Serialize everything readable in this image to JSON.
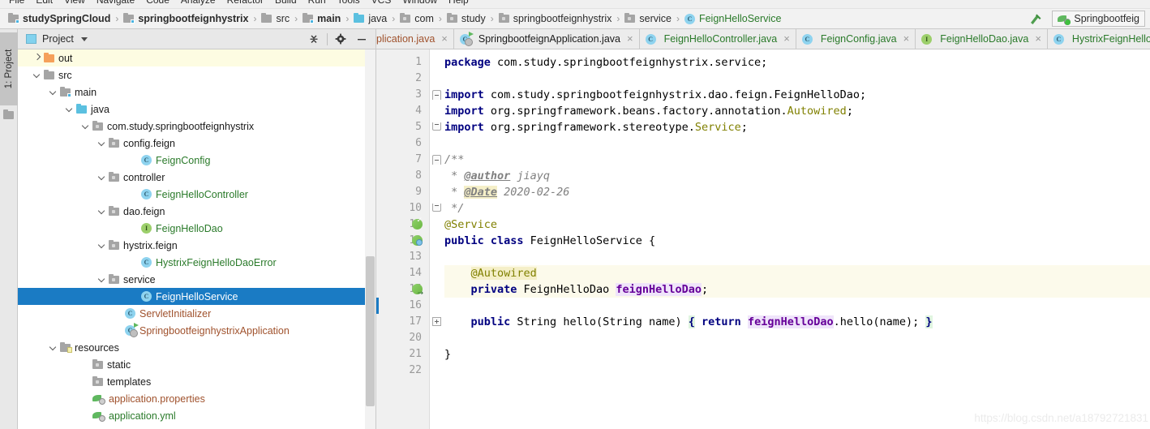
{
  "menubar": {
    "items": [
      "File",
      "Edit",
      "View",
      "Navigate",
      "Code",
      "Analyze",
      "Refactor",
      "Build",
      "Run",
      "Tools",
      "VCS",
      "Window",
      "Help"
    ]
  },
  "breadcrumb": {
    "items": [
      {
        "label": "studySpringCloud",
        "icon": "module-folder-icon",
        "bold": true
      },
      {
        "label": "springbootfeignhystrix",
        "icon": "module-folder-icon",
        "bold": true
      },
      {
        "label": "src",
        "icon": "folder-icon",
        "bold": false
      },
      {
        "label": "main",
        "icon": "source-folder-icon",
        "bold": true
      },
      {
        "label": "java",
        "icon": "java-folder-icon",
        "bold": false
      },
      {
        "label": "com",
        "icon": "package-icon",
        "bold": false
      },
      {
        "label": "study",
        "icon": "package-icon",
        "bold": false
      },
      {
        "label": "springbootfeignhystrix",
        "icon": "package-icon",
        "bold": false
      },
      {
        "label": "service",
        "icon": "package-icon",
        "bold": false
      },
      {
        "label": "FeignHelloService",
        "icon": "class-icon",
        "bold": false,
        "green": true
      }
    ]
  },
  "toolbar": {
    "build_icon": "hammer-icon",
    "run_configuration": "Springbootfeig"
  },
  "tool_window_tab": {
    "label": "1: Project",
    "icon": "project-icon"
  },
  "project_panel": {
    "title": "Project",
    "dropdown_icon": "chevron-down-icon",
    "collapse_all_icon": "collapse-all-icon",
    "settings_icon": "gear-icon",
    "hide_icon": "minimize-icon",
    "tree": [
      {
        "label": "out",
        "indent": 2,
        "arrow": "right",
        "icon": "folder-orange-icon",
        "color": "black",
        "highlight": true
      },
      {
        "label": "src",
        "indent": 2,
        "arrow": "down",
        "icon": "folder-icon",
        "color": "black"
      },
      {
        "label": "main",
        "indent": 3,
        "arrow": "down",
        "icon": "source-folder-icon",
        "color": "black"
      },
      {
        "label": "java",
        "indent": 4,
        "arrow": "down",
        "icon": "java-folder-icon",
        "color": "black"
      },
      {
        "label": "com.study.springbootfeignhystrix",
        "indent": 5,
        "arrow": "down",
        "icon": "package-icon",
        "color": "black"
      },
      {
        "label": "config.feign",
        "indent": 6,
        "arrow": "down",
        "icon": "package-icon",
        "color": "black"
      },
      {
        "label": "FeignConfig",
        "indent": 8,
        "arrow": "none",
        "icon": "class-icon",
        "color": "green"
      },
      {
        "label": "controller",
        "indent": 6,
        "arrow": "down",
        "icon": "package-icon",
        "color": "black"
      },
      {
        "label": "FeignHelloController",
        "indent": 8,
        "arrow": "none",
        "icon": "class-icon",
        "color": "green"
      },
      {
        "label": "dao.feign",
        "indent": 6,
        "arrow": "down",
        "icon": "package-icon",
        "color": "black"
      },
      {
        "label": "FeignHelloDao",
        "indent": 8,
        "arrow": "none",
        "icon": "interface-icon",
        "color": "green"
      },
      {
        "label": "hystrix.feign",
        "indent": 6,
        "arrow": "down",
        "icon": "package-icon",
        "color": "black"
      },
      {
        "label": "HystrixFeignHelloDaoError",
        "indent": 8,
        "arrow": "none",
        "icon": "class-icon",
        "color": "green"
      },
      {
        "label": "service",
        "indent": 6,
        "arrow": "down",
        "icon": "package-icon",
        "color": "black"
      },
      {
        "label": "FeignHelloService",
        "indent": 8,
        "arrow": "none",
        "icon": "class-icon",
        "color": "green",
        "selected": true
      },
      {
        "label": "ServletInitializer",
        "indent": 7,
        "arrow": "none",
        "icon": "class-icon",
        "color": "brown"
      },
      {
        "label": "SpringbootfeignhystrixApplication",
        "indent": 7,
        "arrow": "none",
        "icon": "spring-class-icon",
        "color": "brown"
      },
      {
        "label": "resources",
        "indent": 3,
        "arrow": "down",
        "icon": "resource-folder-icon",
        "color": "black"
      },
      {
        "label": "static",
        "indent": 5,
        "arrow": "none",
        "icon": "package-icon",
        "color": "black"
      },
      {
        "label": "templates",
        "indent": 5,
        "arrow": "none",
        "icon": "package-icon",
        "color": "black"
      },
      {
        "label": "application.properties",
        "indent": 5,
        "arrow": "none",
        "icon": "spring-file-icon",
        "color": "brown"
      },
      {
        "label": "application.yml",
        "indent": 5,
        "arrow": "none",
        "icon": "spring-file-icon",
        "color": "green"
      }
    ]
  },
  "editor_tabs": [
    {
      "label": "plication.java",
      "icon": "none",
      "color": "brown",
      "clipped": true,
      "close": "×"
    },
    {
      "label": "SpringbootfeignApplication.java",
      "icon": "spring-class-icon",
      "color": "black",
      "close": "×"
    },
    {
      "label": "FeignHelloController.java",
      "icon": "class-icon",
      "color": "green",
      "close": "×"
    },
    {
      "label": "FeignConfig.java",
      "icon": "class-icon",
      "color": "green",
      "close": "×"
    },
    {
      "label": "FeignHelloDao.java",
      "icon": "interface-icon",
      "color": "green",
      "close": "×"
    },
    {
      "label": "HystrixFeignHello",
      "icon": "class-icon",
      "color": "green",
      "clippedRight": true
    }
  ],
  "editor": {
    "line_numbers": [
      "1",
      "2",
      "3",
      "4",
      "5",
      "6",
      "7",
      "8",
      "9",
      "10",
      "11",
      "12",
      "13",
      "14",
      "15",
      "16",
      "17",
      "20",
      "21",
      "22"
    ],
    "current_line": "15",
    "code_lines": [
      {
        "n": "1",
        "tokens": [
          {
            "t": "package ",
            "c": "kw"
          },
          {
            "t": "com.study.springbootfeignhystrix.service;",
            "c": "txt"
          }
        ]
      },
      {
        "n": "2",
        "tokens": []
      },
      {
        "n": "3",
        "tokens": [
          {
            "t": "import ",
            "c": "kw"
          },
          {
            "t": "com.study.springbootfeignhystrix.dao.feign.FeignHelloDao;",
            "c": "txt"
          }
        ]
      },
      {
        "n": "4",
        "tokens": [
          {
            "t": "import ",
            "c": "kw"
          },
          {
            "t": "org.springframework.beans.factory.annotation.",
            "c": "txt"
          },
          {
            "t": "Autowired",
            "c": "ann"
          },
          {
            "t": ";",
            "c": "txt"
          }
        ]
      },
      {
        "n": "5",
        "tokens": [
          {
            "t": "import ",
            "c": "kw"
          },
          {
            "t": "org.springframework.stereotype.",
            "c": "txt"
          },
          {
            "t": "Service",
            "c": "ann"
          },
          {
            "t": ";",
            "c": "txt"
          }
        ]
      },
      {
        "n": "6",
        "tokens": []
      },
      {
        "n": "7",
        "tokens": [
          {
            "t": "/**",
            "c": "cmt"
          }
        ]
      },
      {
        "n": "8",
        "tokens": [
          {
            "t": " * ",
            "c": "cmt"
          },
          {
            "t": "@author",
            "c": "cmtTag"
          },
          {
            "t": " jiayq",
            "c": "cmt"
          }
        ]
      },
      {
        "n": "9",
        "tokens": [
          {
            "t": " * ",
            "c": "cmt"
          },
          {
            "t": "@Date",
            "c": "cmtTagHl"
          },
          {
            "t": " 2020-02-26",
            "c": "cmt"
          }
        ]
      },
      {
        "n": "10",
        "tokens": [
          {
            "t": " */",
            "c": "cmt"
          }
        ]
      },
      {
        "n": "11",
        "tokens": [
          {
            "t": "@Service",
            "c": "ann"
          }
        ]
      },
      {
        "n": "12",
        "tokens": [
          {
            "t": "public class ",
            "c": "kw"
          },
          {
            "t": "FeignHelloService {",
            "c": "txt"
          }
        ]
      },
      {
        "n": "13",
        "tokens": []
      },
      {
        "n": "14",
        "tokens": [
          {
            "t": "    ",
            "c": "txt"
          },
          {
            "t": "@Autowired",
            "c": "annb"
          }
        ]
      },
      {
        "n": "15",
        "tokens": [
          {
            "t": "    ",
            "c": "txt"
          },
          {
            "t": "private ",
            "c": "kw"
          },
          {
            "t": "FeignHelloDao ",
            "c": "txt"
          },
          {
            "t": "feignHelloDao",
            "c": "fld"
          },
          {
            "t": ";",
            "c": "txt"
          }
        ]
      },
      {
        "n": "16",
        "tokens": []
      },
      {
        "n": "17",
        "tokens": [
          {
            "t": "    ",
            "c": "txt"
          },
          {
            "t": "public ",
            "c": "kw"
          },
          {
            "t": "String hello(String name) ",
            "c": "txt"
          },
          {
            "t": "{",
            "c": "brace-hl"
          },
          {
            "t": " ",
            "c": "txt"
          },
          {
            "t": "return ",
            "c": "kw"
          },
          {
            "t": "feignHelloDao",
            "c": "fld"
          },
          {
            "t": ".hello(name); ",
            "c": "txt"
          },
          {
            "t": "}",
            "c": "brace-hl"
          }
        ]
      },
      {
        "n": "20",
        "tokens": []
      },
      {
        "n": "21",
        "tokens": [
          {
            "t": "}",
            "c": "txt"
          }
        ]
      },
      {
        "n": "22",
        "tokens": []
      }
    ],
    "gutter_marks": [
      {
        "n": "11",
        "icon": "spring-bean-check-icon"
      },
      {
        "n": "12",
        "icon": "spring-bean-icon"
      },
      {
        "n": "15",
        "icon": "spring-autowire-icon"
      }
    ]
  },
  "watermark": "https://blog.csdn.net/a18792721831"
}
